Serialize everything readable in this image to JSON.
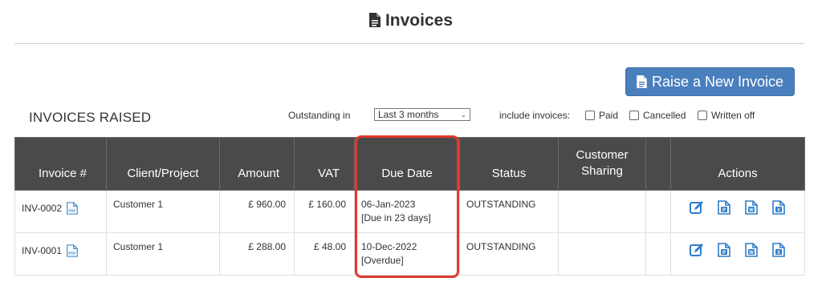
{
  "header": {
    "title": "Invoices",
    "icon": "document-icon"
  },
  "toolbar": {
    "raise_label": "Raise a New Invoice"
  },
  "section": {
    "title": "INVOICES RAISED"
  },
  "filters": {
    "outstanding_label": "Outstanding in",
    "period_value": "Last 3 months",
    "include_label": "include invoices:",
    "paid_label": "Paid",
    "cancelled_label": "Cancelled",
    "written_off_label": "Written off"
  },
  "table": {
    "headers": {
      "invoice": "Invoice #",
      "client": "Client/Project",
      "amount": "Amount",
      "vat": "VAT",
      "due_date": "Due Date",
      "status": "Status",
      "customer_sharing": "Customer Sharing",
      "blank": "",
      "actions": "Actions"
    },
    "rows": [
      {
        "invoice": "INV-0002",
        "client": "Customer 1",
        "amount": "£ 960.00",
        "vat": "£ 160.00",
        "due_date": "06-Jan-2023",
        "due_note": "[Due in 23 days]",
        "status": "OUTSTANDING",
        "sharing": ""
      },
      {
        "invoice": "INV-0001",
        "client": "Customer 1",
        "amount": "£ 288.00",
        "vat": "£ 48.00",
        "due_date": "10-Dec-2022",
        "due_note": "[Overdue]",
        "status": "OUTSTANDING",
        "sharing": ""
      }
    ],
    "pdf_badge_text": "PDF",
    "action_icons": [
      "edit-icon",
      "p-doc-icon",
      "w-doc-icon",
      "x-doc-icon"
    ],
    "action_letters": {
      "p": "P",
      "w": "W",
      "x": "X"
    }
  },
  "colors": {
    "header_bg": "#4a4a4a",
    "button_bg": "#4a7fbd",
    "icon_blue": "#2e7dc8",
    "highlight": "#e0392b"
  }
}
